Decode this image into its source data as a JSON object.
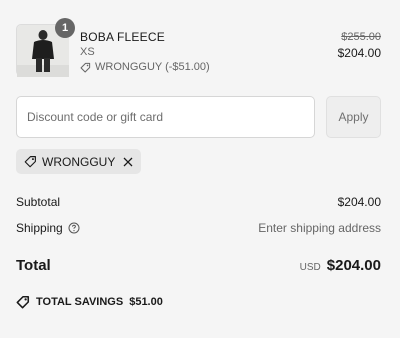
{
  "cart_item": {
    "quantity": "1",
    "name": "BOBA FLEECE",
    "variant": "XS",
    "discount_applied": "WRONGGUY (-$51.00)",
    "original_price": "$255.00",
    "price": "$204.00"
  },
  "discount_form": {
    "placeholder": "Discount code or gift card",
    "apply_label": "Apply"
  },
  "applied_code": {
    "code": "WRONGGUY"
  },
  "summary": {
    "subtotal_label": "Subtotal",
    "subtotal_value": "$204.00",
    "shipping_label": "Shipping",
    "shipping_value": "Enter shipping address",
    "total_label": "Total",
    "currency": "USD",
    "total_value": "$204.00",
    "savings_label": "TOTAL SAVINGS",
    "savings_value": "$51.00"
  },
  "icons": {
    "tag": "tag-icon",
    "close": "close-icon",
    "help": "help-circle-icon"
  }
}
